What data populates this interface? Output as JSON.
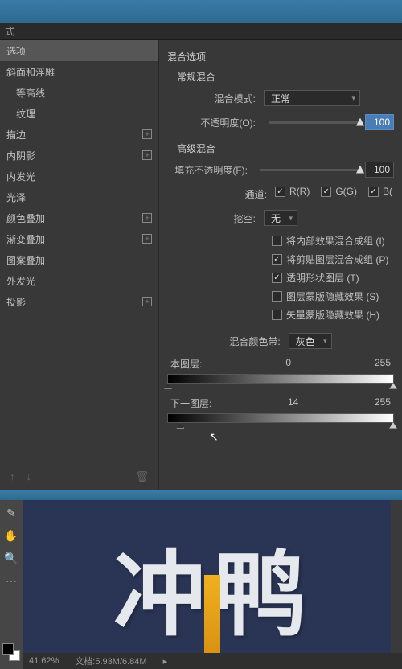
{
  "title_seg": "式",
  "left": {
    "items": [
      {
        "label": "选项",
        "selected": true,
        "plus": false,
        "indent": false
      },
      {
        "label": "斜面和浮雕",
        "plus": false,
        "indent": false
      },
      {
        "label": "等高线",
        "plus": false,
        "indent": true
      },
      {
        "label": "纹理",
        "plus": false,
        "indent": true
      },
      {
        "label": "描边",
        "plus": true,
        "indent": false
      },
      {
        "label": "内阴影",
        "plus": true,
        "indent": false
      },
      {
        "label": "内发光",
        "plus": false,
        "indent": false
      },
      {
        "label": "光泽",
        "plus": false,
        "indent": false
      },
      {
        "label": "颜色叠加",
        "plus": true,
        "indent": false
      },
      {
        "label": "渐变叠加",
        "plus": true,
        "indent": false
      },
      {
        "label": "图案叠加",
        "plus": false,
        "indent": false
      },
      {
        "label": "外发光",
        "plus": false,
        "indent": false
      },
      {
        "label": "投影",
        "plus": true,
        "indent": false
      }
    ]
  },
  "right": {
    "title": "混合选项",
    "normal_title": "常规混合",
    "blend_mode_label": "混合模式:",
    "blend_mode_value": "正常",
    "opacity_label": "不透明度(O):",
    "opacity_value": "100",
    "adv_title": "高级混合",
    "fill_label": "填充不透明度(F):",
    "fill_value": "100",
    "channel_label": "通道:",
    "ch_r": "R(R)",
    "ch_g": "G(G)",
    "ch_b": "B(",
    "knockout_label": "挖空:",
    "knockout_value": "无",
    "cb1": "将内部效果混合成组 (I)",
    "cb2": "将剪贴图层混合成组 (P)",
    "cb3": "透明形状图层 (T)",
    "cb4": "图层蒙版隐藏效果 (S)",
    "cb5": "矢量蒙版隐藏效果 (H)",
    "blend_band_label": "混合颜色带:",
    "blend_band_value": "灰色",
    "this_layer": "本图层:",
    "this_low": "0",
    "this_high": "255",
    "under_layer": "下一图层:",
    "under_low": "14",
    "under_high": "255"
  },
  "canvas": {
    "char1": "冲",
    "char2": "鸭"
  },
  "status": {
    "zoom": "41.62%",
    "doc": "文档:5.93M/6.84M"
  }
}
